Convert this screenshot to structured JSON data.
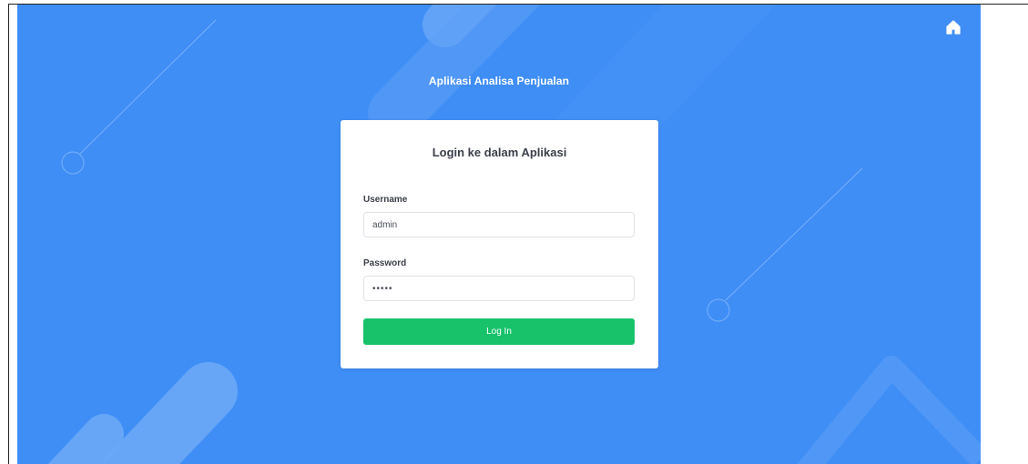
{
  "app": {
    "title": "Aplikasi Analisa Penjualan",
    "home_icon": "home-icon"
  },
  "login": {
    "title": "Login ke dalam Aplikasi",
    "username_label": "Username",
    "username_value": "admin",
    "password_label": "Password",
    "password_value": "admin",
    "submit_label": "Log In"
  },
  "colors": {
    "background": "#3f8ef6",
    "card": "#ffffff",
    "button": "#17c26b",
    "text": "#3b3f4a"
  }
}
